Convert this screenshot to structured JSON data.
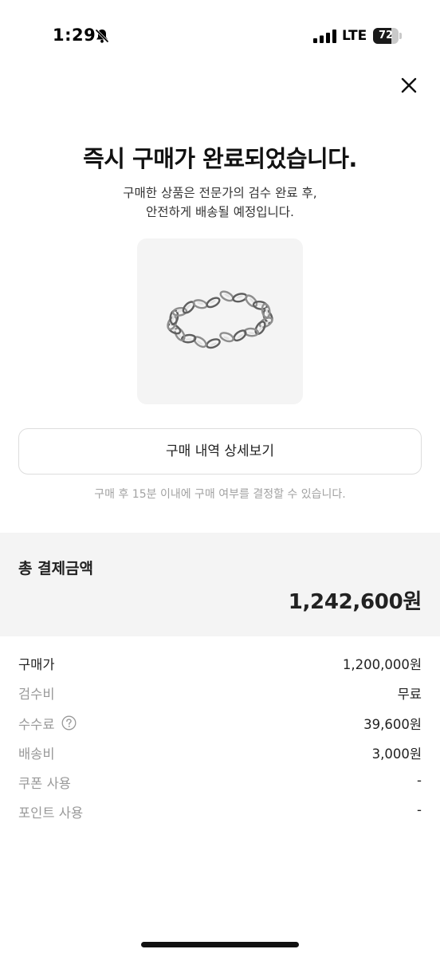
{
  "status_bar": {
    "time": "1:29",
    "network": "LTE",
    "battery": "72",
    "battery_level": 0.72
  },
  "icons": {
    "close": "close-icon",
    "bell": "bell-slash-icon",
    "signal": "signal-icon",
    "help": "question-circle-icon"
  },
  "header": {
    "title": "즉시 구매가 완료되었습니다.",
    "subtitle_line1": "구매한 상품은 전문가의 검수 완료 후,",
    "subtitle_line2": "안전하게 배송될 예정입니다."
  },
  "actions": {
    "detail_button": "구매 내역 상세보기",
    "notice": "구매 후 15분 이내에 구매 여부를 결정할 수 있습니다."
  },
  "total": {
    "label": "총 결제금액",
    "amount": "1,242,600원"
  },
  "breakdown": [
    {
      "label": "구매가",
      "value": "1,200,000원"
    },
    {
      "label": "검수비",
      "value": "무료"
    },
    {
      "label": "수수료",
      "value": "39,600원"
    },
    {
      "label": "배송비",
      "value": "3,000원"
    },
    {
      "label": "쿠폰 사용",
      "value": "-"
    },
    {
      "label": "포인트 사용",
      "value": "-"
    }
  ],
  "colors": {
    "background": "#ffffff",
    "section_background": "#f4f4f4",
    "primary_text": "#222222",
    "secondary_text": "#999999",
    "notice_text": "#a2a2a2"
  }
}
